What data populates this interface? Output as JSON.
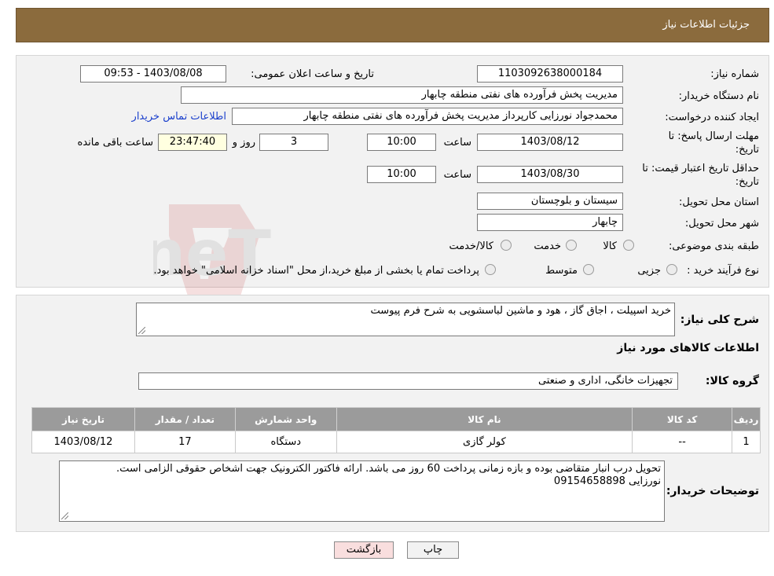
{
  "header": {
    "title": "جزئیات اطلاعات نیاز"
  },
  "form": {
    "need_number_label": "شماره نیاز:",
    "need_number": "1103092638000184",
    "announce_label": "تاریخ و ساعت اعلان عمومی:",
    "announce_value": "1403/08/08 - 09:53",
    "buyer_org_label": "نام دستگاه خریدار:",
    "buyer_org": "مدیریت پخش فرآورده های نفتی منطقه چابهار",
    "creator_label": "ایجاد کننده درخواست:",
    "creator": "محمدجواد نورزایی کارپرداز مدیریت پخش فرآورده های نفتی منطقه چابهار",
    "contact_link": "اطلاعات تماس خریدار",
    "deadline_label_1": "مهلت ارسال پاسخ: تا",
    "deadline_label_2": "تاریخ:",
    "deadline_date": "1403/08/12",
    "time_label": "ساعت",
    "deadline_time": "10:00",
    "days": "3",
    "days_label": "روز و",
    "remaining": "23:47:40",
    "remaining_label": "ساعت باقی مانده",
    "validity_label_1": "حداقل تاریخ اعتبار قیمت: تا",
    "validity_label_2": "تاریخ:",
    "validity_date": "1403/08/30",
    "validity_time": "10:00",
    "province_label": "استان محل تحویل:",
    "province": "سیستان و بلوچستان",
    "city_label": "شهر محل تحویل:",
    "city": "چابهار",
    "category_label": "طبقه بندی موضوعی:",
    "category_options": [
      "کالا",
      "خدمت",
      "کالا/خدمت"
    ],
    "process_label": "نوع فرآیند خرید :",
    "process_options": [
      "جزیی",
      "متوسط"
    ],
    "process_note": "پرداخت تمام یا بخشی از مبلغ خرید،از محل \"اسناد خزانه اسلامی\" خواهد بود."
  },
  "details": {
    "summary_label": "شرح کلی نیاز:",
    "summary": "خرید اسپیلت ، اجاق گاز ، هود و ماشین لباسشویی  به شرح فرم پیوست",
    "goods_section_title": "اطلاعات کالاهای مورد نیاز",
    "group_label": "گروه کالا:",
    "group": "تجهیزات خانگی، اداری و صنعتی",
    "table": {
      "headers": [
        "ردیف",
        "کد کالا",
        "نام کالا",
        "واحد شمارش",
        "تعداد / مقدار",
        "تاریخ نیاز"
      ],
      "rows": [
        [
          "1",
          "--",
          "کولر گازی",
          "دستگاه",
          "17",
          "1403/08/12"
        ]
      ]
    },
    "buyer_notes_label": "توضیحات خریدار:",
    "buyer_notes_line1": "تحویل درب انبار متقاضی بوده و بازه زمانی پرداخت 60 روز می باشد. ارائه فاکتور الکترونیک جهت اشخاص حقوقی الزامی است.",
    "buyer_notes_line2": "نورزایی 09154658898"
  },
  "buttons": {
    "print": "چاپ",
    "back": "بازگشت"
  },
  "watermark_text": "AriaTender.neT",
  "colors": {
    "header_bg": "#8b6b3d",
    "panel_bg": "#f2f2f2",
    "table_header_bg": "#9b9b9b",
    "link": "#1a3fcc",
    "back_button_bg": "#f9dede"
  }
}
